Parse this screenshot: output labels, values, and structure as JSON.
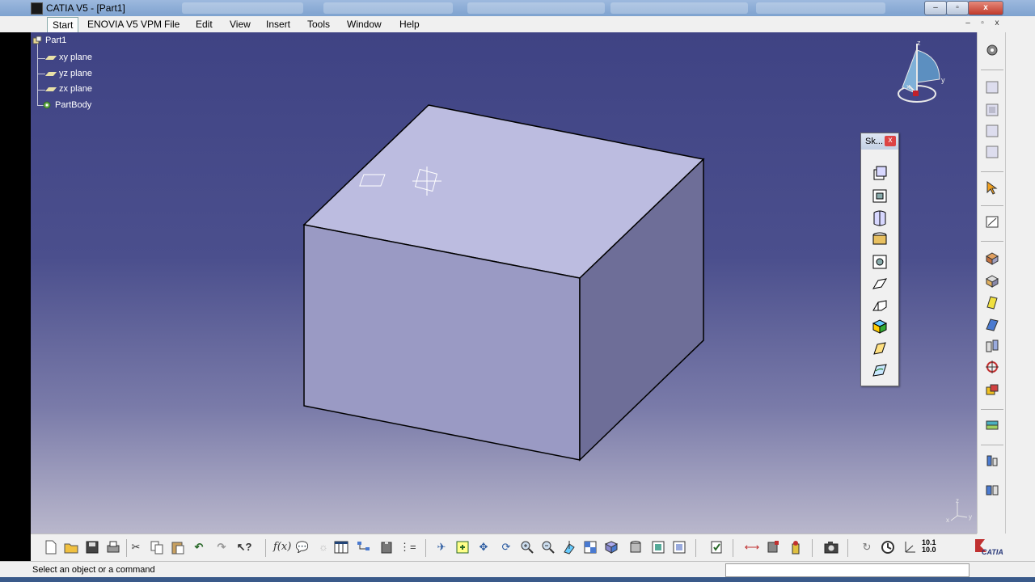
{
  "window": {
    "title": "CATIA V5 - [Part1]",
    "controls": {
      "minimize": "–",
      "restore": "▫",
      "close": "x"
    }
  },
  "menubar": {
    "items": [
      {
        "id": "start",
        "label": "Start"
      },
      {
        "id": "enovia",
        "label": "ENOVIA V5 VPM"
      },
      {
        "id": "file",
        "label": "File"
      },
      {
        "id": "edit",
        "label": "Edit"
      },
      {
        "id": "view",
        "label": "View"
      },
      {
        "id": "insert",
        "label": "Insert"
      },
      {
        "id": "tools",
        "label": "Tools"
      },
      {
        "id": "window",
        "label": "Window"
      },
      {
        "id": "help",
        "label": "Help"
      }
    ]
  },
  "tree": {
    "root": "Part1",
    "children": [
      "xy plane",
      "yz plane",
      "zx plane",
      "PartBody"
    ]
  },
  "compass": {
    "axis_labels": [
      "z",
      "x",
      "y"
    ]
  },
  "axis_triad": {
    "labels": [
      "z",
      "x",
      "y"
    ]
  },
  "sketch_toolbar": {
    "title": "Sk...",
    "close": "x",
    "tools": [
      "pad-icon",
      "pocket-icon",
      "shaft-icon",
      "groove-icon",
      "hole-icon",
      "rib-icon",
      "slot-icon",
      "solid-combine-icon",
      "stiffener-icon",
      "multi-section-solid-icon"
    ]
  },
  "right_toolbar": {
    "tools": [
      "compass-gear-icon",
      "catalog-icon",
      "catalog-2-icon",
      "catalog-3-icon",
      "catalog-4-icon",
      "select-arrow-icon",
      "sketch-icon",
      "reference-element-icon",
      "dress-up-icon",
      "box-icon",
      "thickness-icon",
      "transformation-icon",
      "axis-system-icon",
      "boolean-icon",
      "surface-based-icon",
      "measure-icon",
      "apply-material-icon"
    ]
  },
  "bottom_toolbar": {
    "tools": [
      "new-icon",
      "open-icon",
      "save-icon",
      "print-icon",
      "cut-icon",
      "copy-icon",
      "paste-icon",
      "undo-icon",
      "redo-icon",
      "whats-this-icon",
      "formula-icon",
      "knowledge-icon",
      "light-icon",
      "table-icon",
      "tree-expand-icon",
      "catalog-browser-icon",
      "edit-link-icon",
      "fly-mode-icon",
      "fit-all-icon",
      "pan-icon",
      "rotate-icon",
      "zoom-in-icon",
      "zoom-out-icon",
      "normal-view-icon",
      "multi-view-icon",
      "iso-view-icon",
      "shading-icon",
      "hide-show-icon",
      "swap-space-icon",
      "update-icon",
      "measure-between-icon",
      "measure-item-icon",
      "measure-inertia-icon",
      "capture-icon",
      "refresh-icon",
      "knowledge-advisor-icon",
      "axis-system-icon",
      "scale-icon"
    ],
    "scale_top": "10.1",
    "scale_bottom": "10.0",
    "brand": "CATIA"
  },
  "status": {
    "message": "Select an object or a command",
    "command_placeholder": ""
  },
  "colors": {
    "viewport_top": "#3f4384",
    "viewport_bottom": "#b9b7cc",
    "box_top": "#bcbce0",
    "box_front": "#9a9ac4",
    "box_side": "#6e6e98"
  }
}
